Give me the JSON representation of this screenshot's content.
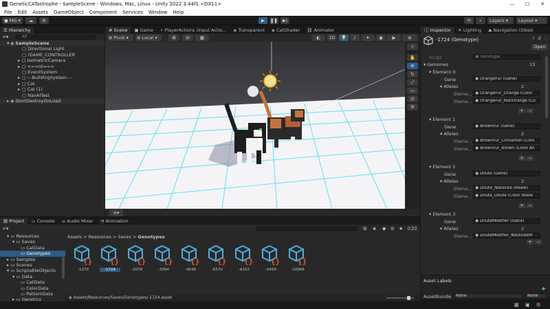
{
  "window": {
    "title": "GeneticCATastrophe - SampleScene - Windows, Mac, Linux - Unity 2022.3.44f1 <DX11>"
  },
  "menu": [
    "File",
    "Edit",
    "Assets",
    "GameObject",
    "Component",
    "Services",
    "Window",
    "Help"
  ],
  "toolbar": {
    "account": "MG",
    "layers": "Layers",
    "layout": "Layout"
  },
  "hierarchy": {
    "tab": "Hierarchy",
    "search_placeholder": "All",
    "scene": "SampleScene",
    "items": [
      "Directional Light",
      "!GAME_CONTROLLER",
      "IsometricCamera",
      "<==UI==>",
      "EventSystem",
      "---BuildingSystem---",
      "Cat",
      "Cat (1)",
      "NavAITest"
    ],
    "dontdestroy": "DontDestroyOnLoad"
  },
  "scene_tabs": [
    "Scene",
    "Game",
    "PlayerActions (Input Actio...",
    "Transparent",
    "CatShader",
    "Animator"
  ],
  "scene_toolbar": {
    "pivot": "Pivot",
    "local": "Local",
    "mode_2d": "2D"
  },
  "inspector": {
    "tabs": [
      "Inspector",
      "Lighting",
      "Navigation (Obsol"
    ],
    "title": "-1724 (Genotype)",
    "open_button": "Open",
    "script_label": "Script",
    "script_value": "Genotype",
    "genomes_label": "Genomes",
    "genomes_count": "13",
    "elements": [
      {
        "name": "Element 0",
        "gene_label": "Gene",
        "gene": "OrangeFur (Gene)",
        "alleles_label": "Alleles",
        "alleles_count": "2",
        "alleles": [
          "OrangeFur_Orange (Color",
          "OrangeFur_NonOrange (Co"
        ]
      },
      {
        "name": "Element 1",
        "gene_label": "Gene",
        "gene": "BrownFur (Gene)",
        "alleles_label": "Alleles",
        "alleles_count": "2",
        "alleles": [
          "BrownFur_Cinnamon (Colo",
          "BrownFur_Brown (Color All"
        ]
      },
      {
        "name": "Element 2",
        "gene_label": "Gene",
        "gene": "Dilute (Gene)",
        "alleles_label": "Alleles",
        "alleles_count": "2",
        "alleles": [
          "Dilute_NoDilute (Allele)",
          "Dilute_Dilute (Color Allele"
        ]
      },
      {
        "name": "Element 3",
        "gene_label": "Gene",
        "gene": "DiluteModifier (Gene)",
        "alleles_label": "Alleles",
        "alleles_count": "2",
        "alleles": [
          "DiluteModifier_NoDiluteM"
        ]
      }
    ],
    "element_label": "Eleme...",
    "asset_labels": "Asset Labels",
    "asset_bundle_label": "AssetBundle",
    "asset_bundle_value": "None",
    "asset_variant_value": "None"
  },
  "project": {
    "tabs": [
      "Project",
      "Console",
      "Audio Mixer",
      "Animation"
    ],
    "tree": [
      "Resources",
      "Saves",
      "CatData",
      "Genotypes",
      "Samples",
      "Scenes",
      "ScriptableObjects",
      "Data",
      "CatData",
      "ColorData",
      "PatternData",
      "Genetics"
    ],
    "breadcrumb": [
      "Assets",
      "Resources",
      "Saves",
      "Genotypes"
    ],
    "count": "20",
    "assets": [
      "-1270",
      "-1724",
      "-3078",
      "-3094",
      "-4638",
      "-6572",
      "-8102",
      "-9454",
      "-10966"
    ],
    "path": "Assets/Resources/Saves/Genotypes/-1724.asset"
  },
  "colors": {
    "selection": "#2c5d87",
    "panel": "#282828",
    "background": "#191919",
    "asset_icon": "#4ab0e0",
    "asset_braces": "#e05a3a",
    "grid": "#5fe0f0"
  }
}
